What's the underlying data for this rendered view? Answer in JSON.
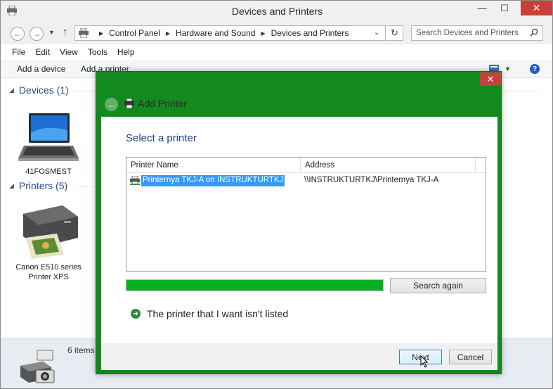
{
  "window": {
    "title": "Devices and Printers",
    "controls": {
      "minimize": "—",
      "maximize": "☐",
      "close": "✕"
    }
  },
  "address_bar": {
    "breadcrumbs": [
      "Control Panel",
      "Hardware and Sound",
      "Devices and Printers"
    ],
    "search_placeholder": "Search Devices and Printers"
  },
  "menu": [
    "File",
    "Edit",
    "View",
    "Tools",
    "Help"
  ],
  "command_bar": {
    "add_device": "Add a device",
    "add_printer": "Add a printer",
    "help": "?"
  },
  "sections": {
    "devices": {
      "label": "Devices (1)",
      "items": [
        {
          "name": "41FOSMEST",
          "icon": "laptop-icon"
        }
      ]
    },
    "printers": {
      "label": "Printers (5)",
      "items": [
        {
          "name": "Canon E510 series Printer XPS",
          "icon": "printer-icon"
        }
      ]
    }
  },
  "status": {
    "text": "6 items"
  },
  "dialog": {
    "title": "Add Printer",
    "close": "✕",
    "heading": "Select a printer",
    "columns": [
      "Printer Name",
      "Address"
    ],
    "rows": [
      {
        "name": "Printernya TKJ-A on INSTRUKTURTKJ",
        "address": "\\\\INSTRUKTURTKJ\\Printernya TKJ-A",
        "selected": true
      }
    ],
    "progress": 1.0,
    "search_again": "Search again",
    "not_listed": "The printer that I want isn't listed",
    "next": "Next",
    "cancel": "Cancel"
  },
  "colors": {
    "dialog_frame": "#138a1e",
    "progress_fill": "#06b025",
    "selection": "#3399ff",
    "close_red": "#c7413a",
    "heading_blue": "#1e3f8a"
  }
}
